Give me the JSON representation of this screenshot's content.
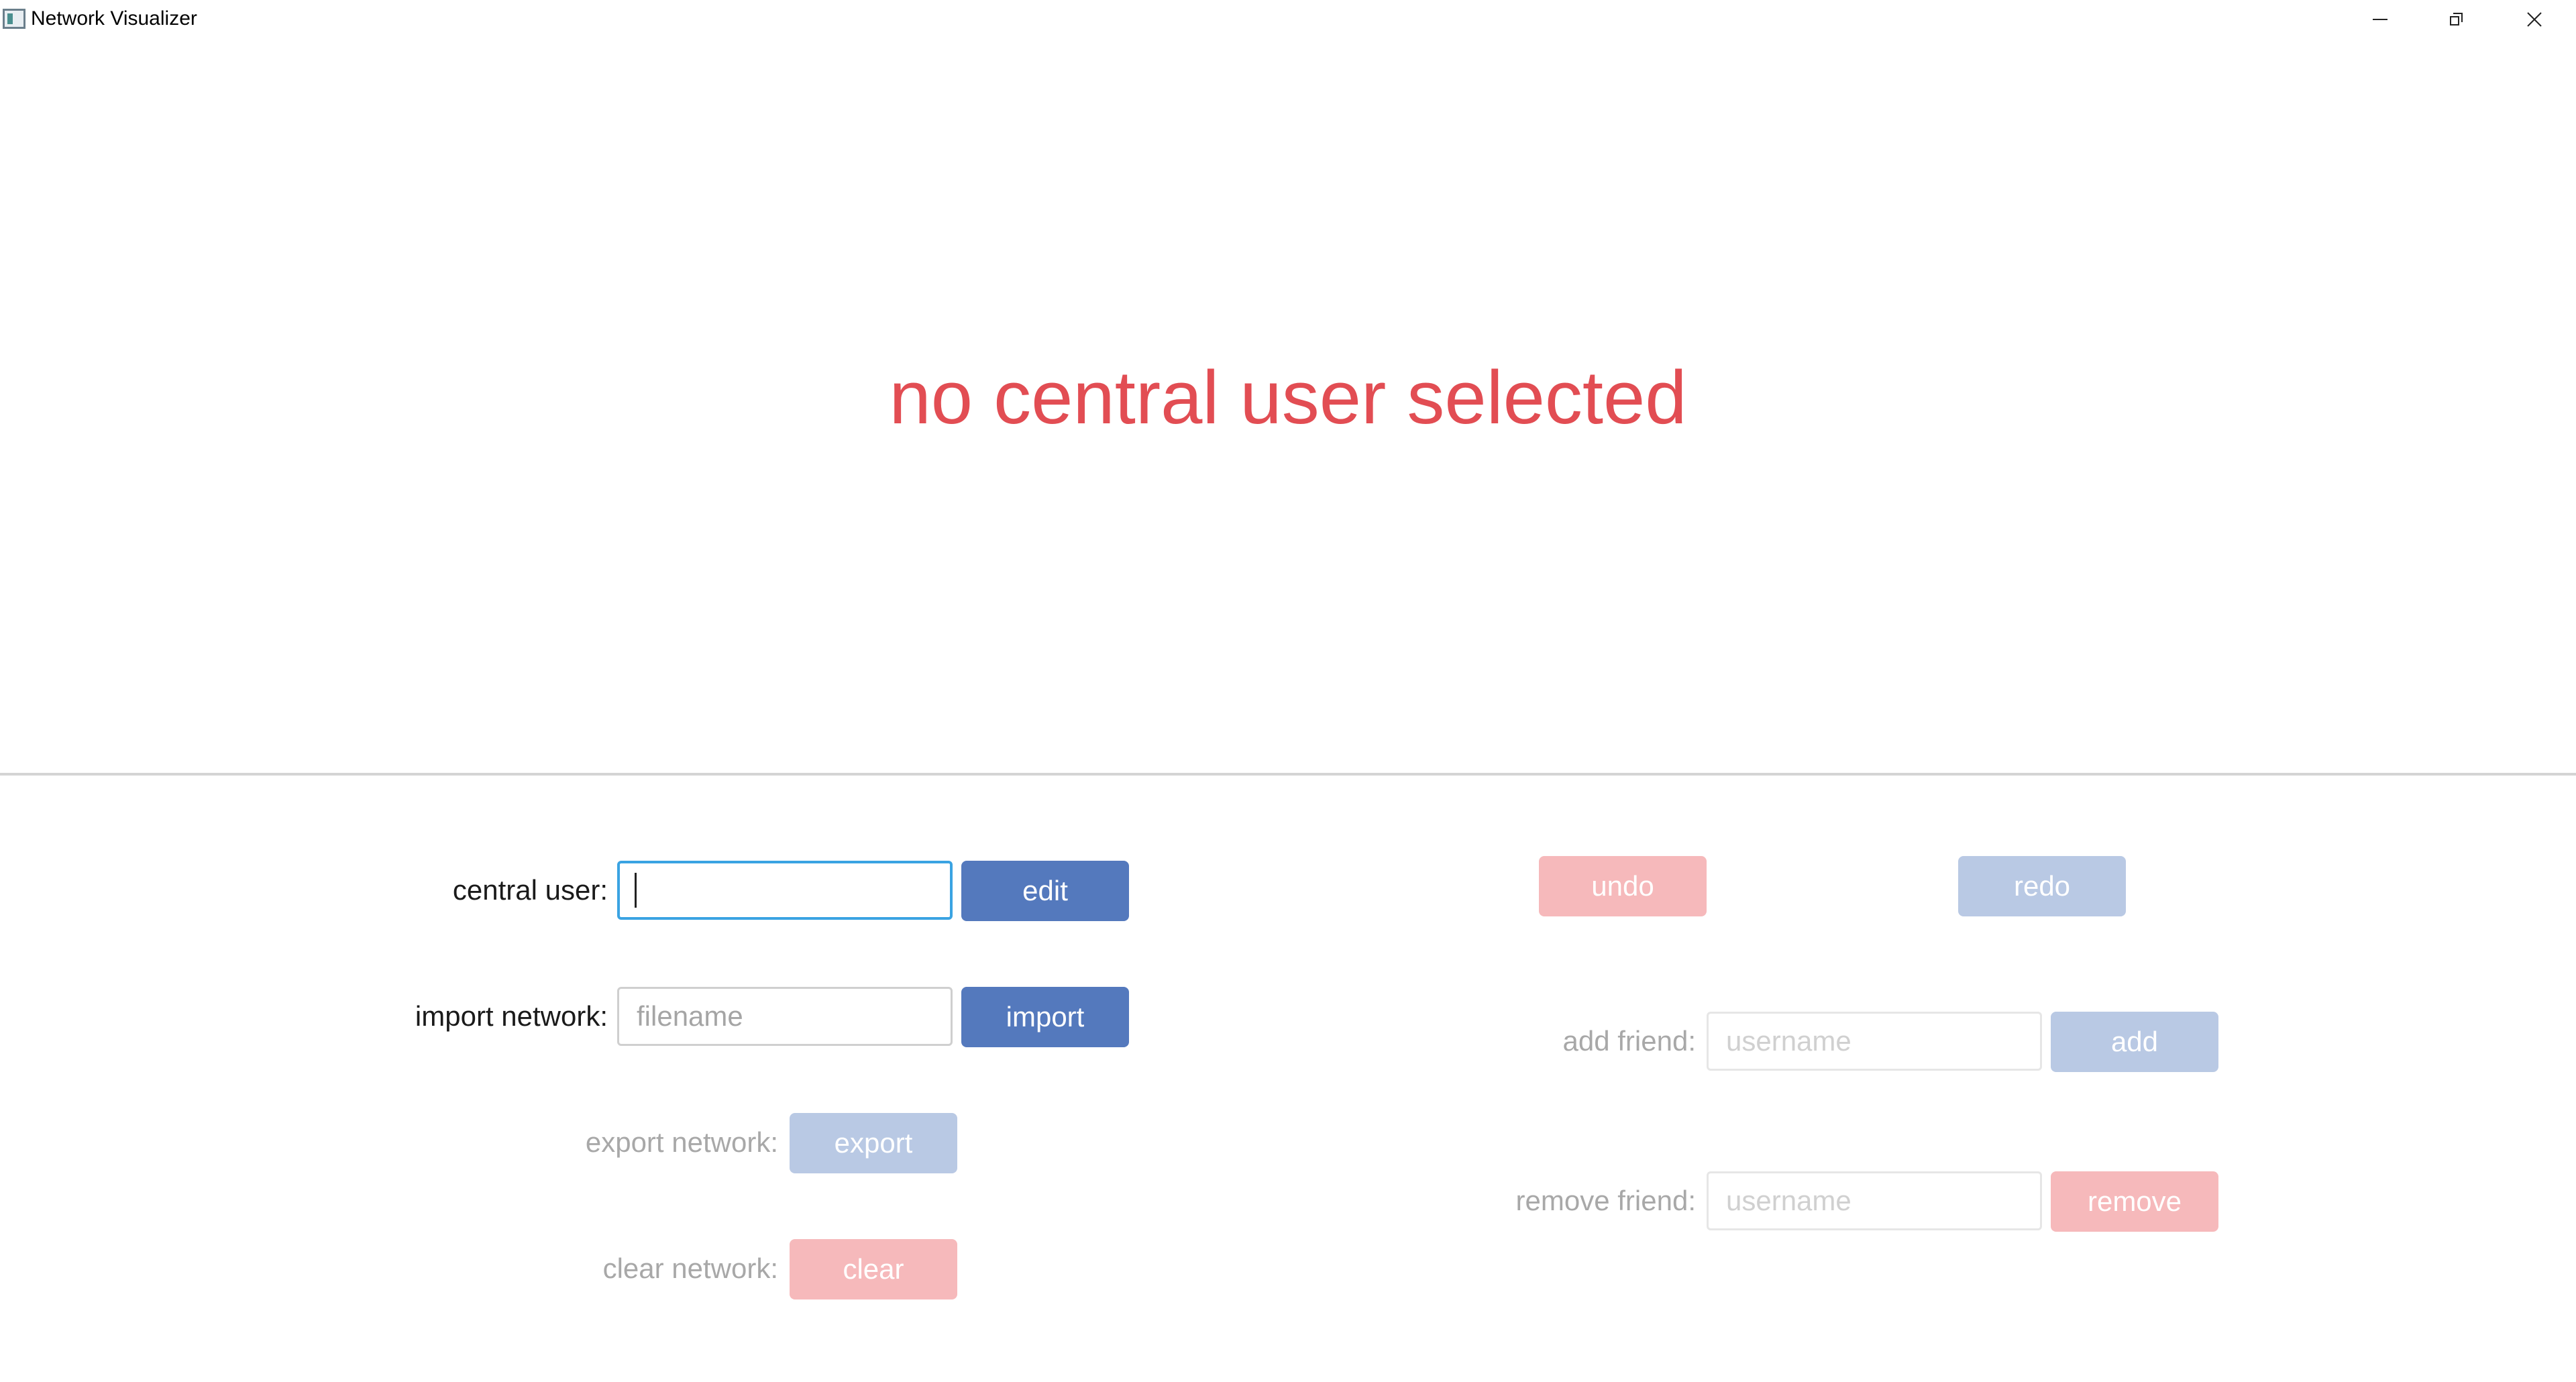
{
  "window": {
    "title": "Network Visualizer"
  },
  "canvas": {
    "status_message": "no central user selected"
  },
  "controls": {
    "central_user": {
      "label": "central user:",
      "value": "",
      "button": "edit"
    },
    "import_network": {
      "label": "import network:",
      "placeholder": "filename",
      "button": "import"
    },
    "export_network": {
      "label": "export network:",
      "button": "export"
    },
    "clear_network": {
      "label": "clear network:",
      "button": "clear"
    },
    "undo": {
      "button": "undo"
    },
    "redo": {
      "button": "redo"
    },
    "add_friend": {
      "label": "add friend:",
      "placeholder": "username",
      "button": "add"
    },
    "remove_friend": {
      "label": "remove friend:",
      "placeholder": "username",
      "button": "remove"
    }
  },
  "colors": {
    "status_red": "#e24d53",
    "primary_blue": "#5479bd",
    "disabled_blue": "#b9c9e4",
    "disabled_red": "#f6b9bb",
    "focus_border": "#3aa3e2"
  }
}
